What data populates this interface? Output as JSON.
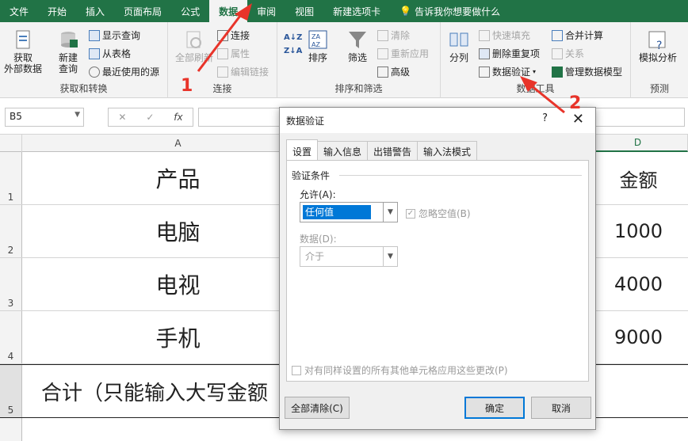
{
  "tabs": [
    {
      "label": "文件",
      "active": false
    },
    {
      "label": "开始",
      "active": false
    },
    {
      "label": "插入",
      "active": false
    },
    {
      "label": "页面布局",
      "active": false
    },
    {
      "label": "公式",
      "active": false
    },
    {
      "label": "数据",
      "active": true
    },
    {
      "label": "审阅",
      "active": false
    },
    {
      "label": "视图",
      "active": false
    },
    {
      "label": "新建选项卡",
      "active": false
    }
  ],
  "tell_me": "告诉我你想要做什么",
  "ribbon": {
    "get_transform": {
      "label": "获取和转换",
      "get_external": "获取\n外部数据",
      "new_query": "新建\n查询",
      "show_queries": "显示查询",
      "from_table": "从表格",
      "recent_sources": "最近使用的源"
    },
    "connections": {
      "label": "连接",
      "refresh_all": "全部刷新",
      "connections": "连接",
      "properties": "属性",
      "edit_links": "编辑链接"
    },
    "sort_filter": {
      "label": "排序和筛选",
      "sort": "排序",
      "filter": "筛选",
      "clear": "清除",
      "reapply": "重新应用",
      "advanced": "高级"
    },
    "data_tools": {
      "label": "数据工具",
      "split": "分列",
      "flash_fill": "快速填充",
      "remove_dup": "删除重复项",
      "data_validation": "数据验证",
      "consolidate": "合并计算",
      "relationships": "关系",
      "manage_model": "管理数据模型"
    },
    "forecast": {
      "label": "预测",
      "whatif": "模拟分析"
    }
  },
  "formula_bar": {
    "name_box": "B5",
    "cancel": "✕",
    "enter": "✓",
    "fx": "fx"
  },
  "columns": [
    "A",
    "D"
  ],
  "rows": [
    {
      "num": "1",
      "a": "产品",
      "d": "金额"
    },
    {
      "num": "2",
      "a": "电脑",
      "d": "1000"
    },
    {
      "num": "3",
      "a": "电视",
      "d": "4000"
    },
    {
      "num": "4",
      "a": "手机",
      "d": "9000"
    },
    {
      "num": "5",
      "a": "合计（只能输入大写金额",
      "d": ""
    }
  ],
  "dialog": {
    "title": "数据验证",
    "help": "?",
    "close": "✕",
    "tabs": [
      "设置",
      "输入信息",
      "出错警告",
      "输入法模式"
    ],
    "section": "验证条件",
    "allow_label": "允许(A):",
    "allow_value": "任何值",
    "ignore_blank": "忽略空值(B)",
    "data_label": "数据(D):",
    "data_value": "介于",
    "apply_all": "对有同样设置的所有其他单元格应用这些更改(P)",
    "clear_all": "全部清除(C)",
    "ok": "确定",
    "cancel": "取消"
  },
  "annotations": {
    "one": "1",
    "two": "2"
  }
}
